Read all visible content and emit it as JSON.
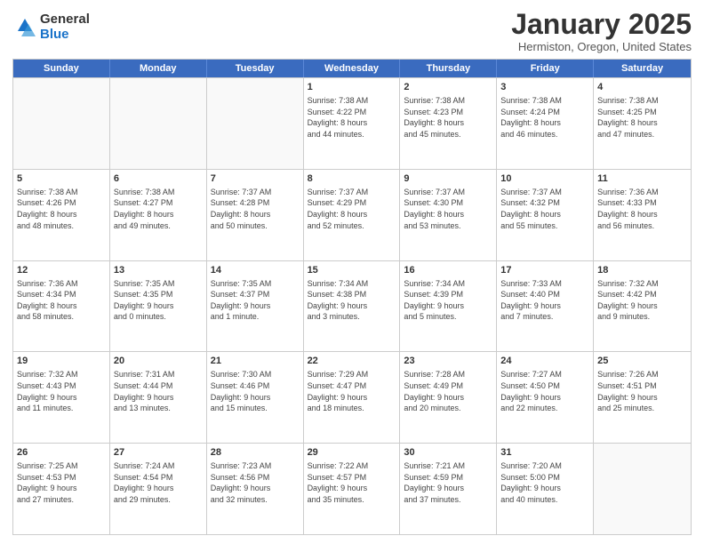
{
  "logo": {
    "general": "General",
    "blue": "Blue"
  },
  "title": "January 2025",
  "location": "Hermiston, Oregon, United States",
  "days": [
    "Sunday",
    "Monday",
    "Tuesday",
    "Wednesday",
    "Thursday",
    "Friday",
    "Saturday"
  ],
  "weeks": [
    [
      {
        "day": "",
        "content": ""
      },
      {
        "day": "",
        "content": ""
      },
      {
        "day": "",
        "content": ""
      },
      {
        "day": "1",
        "content": "Sunrise: 7:38 AM\nSunset: 4:22 PM\nDaylight: 8 hours\nand 44 minutes."
      },
      {
        "day": "2",
        "content": "Sunrise: 7:38 AM\nSunset: 4:23 PM\nDaylight: 8 hours\nand 45 minutes."
      },
      {
        "day": "3",
        "content": "Sunrise: 7:38 AM\nSunset: 4:24 PM\nDaylight: 8 hours\nand 46 minutes."
      },
      {
        "day": "4",
        "content": "Sunrise: 7:38 AM\nSunset: 4:25 PM\nDaylight: 8 hours\nand 47 minutes."
      }
    ],
    [
      {
        "day": "5",
        "content": "Sunrise: 7:38 AM\nSunset: 4:26 PM\nDaylight: 8 hours\nand 48 minutes."
      },
      {
        "day": "6",
        "content": "Sunrise: 7:38 AM\nSunset: 4:27 PM\nDaylight: 8 hours\nand 49 minutes."
      },
      {
        "day": "7",
        "content": "Sunrise: 7:37 AM\nSunset: 4:28 PM\nDaylight: 8 hours\nand 50 minutes."
      },
      {
        "day": "8",
        "content": "Sunrise: 7:37 AM\nSunset: 4:29 PM\nDaylight: 8 hours\nand 52 minutes."
      },
      {
        "day": "9",
        "content": "Sunrise: 7:37 AM\nSunset: 4:30 PM\nDaylight: 8 hours\nand 53 minutes."
      },
      {
        "day": "10",
        "content": "Sunrise: 7:37 AM\nSunset: 4:32 PM\nDaylight: 8 hours\nand 55 minutes."
      },
      {
        "day": "11",
        "content": "Sunrise: 7:36 AM\nSunset: 4:33 PM\nDaylight: 8 hours\nand 56 minutes."
      }
    ],
    [
      {
        "day": "12",
        "content": "Sunrise: 7:36 AM\nSunset: 4:34 PM\nDaylight: 8 hours\nand 58 minutes."
      },
      {
        "day": "13",
        "content": "Sunrise: 7:35 AM\nSunset: 4:35 PM\nDaylight: 9 hours\nand 0 minutes."
      },
      {
        "day": "14",
        "content": "Sunrise: 7:35 AM\nSunset: 4:37 PM\nDaylight: 9 hours\nand 1 minute."
      },
      {
        "day": "15",
        "content": "Sunrise: 7:34 AM\nSunset: 4:38 PM\nDaylight: 9 hours\nand 3 minutes."
      },
      {
        "day": "16",
        "content": "Sunrise: 7:34 AM\nSunset: 4:39 PM\nDaylight: 9 hours\nand 5 minutes."
      },
      {
        "day": "17",
        "content": "Sunrise: 7:33 AM\nSunset: 4:40 PM\nDaylight: 9 hours\nand 7 minutes."
      },
      {
        "day": "18",
        "content": "Sunrise: 7:32 AM\nSunset: 4:42 PM\nDaylight: 9 hours\nand 9 minutes."
      }
    ],
    [
      {
        "day": "19",
        "content": "Sunrise: 7:32 AM\nSunset: 4:43 PM\nDaylight: 9 hours\nand 11 minutes."
      },
      {
        "day": "20",
        "content": "Sunrise: 7:31 AM\nSunset: 4:44 PM\nDaylight: 9 hours\nand 13 minutes."
      },
      {
        "day": "21",
        "content": "Sunrise: 7:30 AM\nSunset: 4:46 PM\nDaylight: 9 hours\nand 15 minutes."
      },
      {
        "day": "22",
        "content": "Sunrise: 7:29 AM\nSunset: 4:47 PM\nDaylight: 9 hours\nand 18 minutes."
      },
      {
        "day": "23",
        "content": "Sunrise: 7:28 AM\nSunset: 4:49 PM\nDaylight: 9 hours\nand 20 minutes."
      },
      {
        "day": "24",
        "content": "Sunrise: 7:27 AM\nSunset: 4:50 PM\nDaylight: 9 hours\nand 22 minutes."
      },
      {
        "day": "25",
        "content": "Sunrise: 7:26 AM\nSunset: 4:51 PM\nDaylight: 9 hours\nand 25 minutes."
      }
    ],
    [
      {
        "day": "26",
        "content": "Sunrise: 7:25 AM\nSunset: 4:53 PM\nDaylight: 9 hours\nand 27 minutes."
      },
      {
        "day": "27",
        "content": "Sunrise: 7:24 AM\nSunset: 4:54 PM\nDaylight: 9 hours\nand 29 minutes."
      },
      {
        "day": "28",
        "content": "Sunrise: 7:23 AM\nSunset: 4:56 PM\nDaylight: 9 hours\nand 32 minutes."
      },
      {
        "day": "29",
        "content": "Sunrise: 7:22 AM\nSunset: 4:57 PM\nDaylight: 9 hours\nand 35 minutes."
      },
      {
        "day": "30",
        "content": "Sunrise: 7:21 AM\nSunset: 4:59 PM\nDaylight: 9 hours\nand 37 minutes."
      },
      {
        "day": "31",
        "content": "Sunrise: 7:20 AM\nSunset: 5:00 PM\nDaylight: 9 hours\nand 40 minutes."
      },
      {
        "day": "",
        "content": ""
      }
    ]
  ]
}
